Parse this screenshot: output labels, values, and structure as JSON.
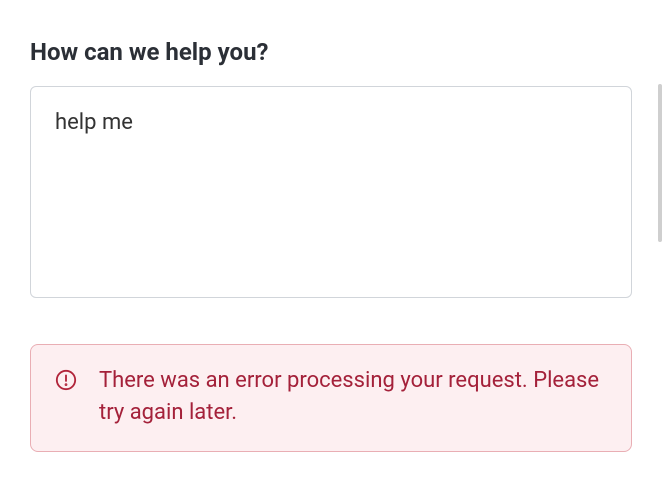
{
  "form": {
    "heading": "How can we help you?",
    "textarea_value": "help me",
    "textarea_placeholder": ""
  },
  "alert": {
    "message": "There was an error processing your request. Please try again later.",
    "icon": "alert-circle-icon",
    "color": "#b1243a",
    "background": "#fdeff1"
  }
}
